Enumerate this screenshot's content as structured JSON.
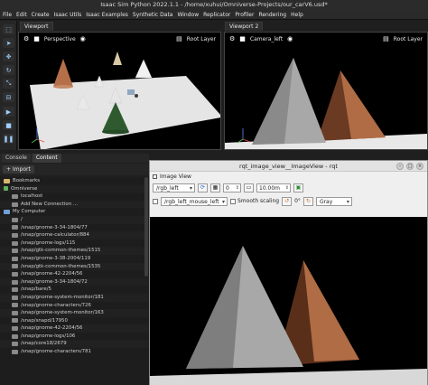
{
  "window": {
    "title": "Isaac Sim Python 2022.1.1 - /home/xuhui/Omniverse-Projects/our_carV6.usd*"
  },
  "menu": [
    "File",
    "Edit",
    "Create",
    "Isaac Utils",
    "Isaac Examples",
    "Synthetic Data",
    "Window",
    "Replicator",
    "Profiler",
    "Rendering",
    "Help"
  ],
  "viewport1": {
    "tab": "Viewport",
    "camera": "Perspective",
    "layer": "Root Layer"
  },
  "viewport2": {
    "tab": "Viewport 2",
    "camera": "Camera_left",
    "layer": "Root Layer"
  },
  "lower_panel": {
    "tabs": [
      "Console",
      "Content"
    ],
    "active_tab": "Content",
    "import_label": "Import"
  },
  "tree": [
    {
      "label": "Bookmarks",
      "icon": "folder-icon",
      "level": 0
    },
    {
      "label": "Omniverse",
      "icon": "omniverse-icon",
      "level": 0
    },
    {
      "label": "localhost",
      "icon": "server-icon",
      "level": 1
    },
    {
      "label": "Add New Connection ...",
      "icon": "add-icon",
      "level": 1
    },
    {
      "label": "My Computer",
      "icon": "computer-icon",
      "level": 0
    },
    {
      "label": "/",
      "icon": "drive-icon",
      "level": 1
    },
    {
      "label": "/snap/gnome-3-34-1804/77",
      "icon": "drive-icon",
      "level": 1
    },
    {
      "label": "/snap/gnome-calculator/884",
      "icon": "drive-icon",
      "level": 1
    },
    {
      "label": "/snap/gnome-logs/115",
      "icon": "drive-icon",
      "level": 1
    },
    {
      "label": "/snap/gtk-common-themes/1515",
      "icon": "drive-icon",
      "level": 1
    },
    {
      "label": "/snap/gnome-3-38-2004/119",
      "icon": "drive-icon",
      "level": 1
    },
    {
      "label": "/snap/gtk-common-themes/1535",
      "icon": "drive-icon",
      "level": 1
    },
    {
      "label": "/snap/gnome-42-2204/56",
      "icon": "drive-icon",
      "level": 1
    },
    {
      "label": "/snap/gnome-3-34-1804/72",
      "icon": "drive-icon",
      "level": 1
    },
    {
      "label": "/snap/bare/5",
      "icon": "drive-icon",
      "level": 1
    },
    {
      "label": "/snap/gnome-system-monitor/181",
      "icon": "drive-icon",
      "level": 1
    },
    {
      "label": "/snap/gnome-characters/726",
      "icon": "drive-icon",
      "level": 1
    },
    {
      "label": "/snap/gnome-system-monitor/163",
      "icon": "drive-icon",
      "level": 1
    },
    {
      "label": "/snap/snapd/17950",
      "icon": "drive-icon",
      "level": 1
    },
    {
      "label": "/snap/gnome-42-2204/56",
      "icon": "drive-icon",
      "level": 1
    },
    {
      "label": "/snap/gnome-logs/106",
      "icon": "drive-icon",
      "level": 1
    },
    {
      "label": "/snap/core18/2679",
      "icon": "drive-icon",
      "level": 1
    },
    {
      "label": "/snap/gnome-characters/781",
      "icon": "drive-icon",
      "level": 1
    }
  ],
  "rqt": {
    "title": "rqt_image_view__ImageView - rqt",
    "plugin_name": "Image View",
    "topic": "/rgb_left",
    "min_value": "0",
    "max_value": "10.00m",
    "mouse_topic": "/rgb_left_mouse_left",
    "smooth_label": "Smooth scaling",
    "rotation": "0°",
    "color_scheme": "Gray"
  },
  "colors": {
    "menu_bg": "#2a2a2a",
    "viewport_bg": "#000000",
    "ground": "#e6e6e6",
    "cone_copper": "#b5704a",
    "cone_gray": "#9a9a9a",
    "cone_green": "#2f5a2f"
  }
}
